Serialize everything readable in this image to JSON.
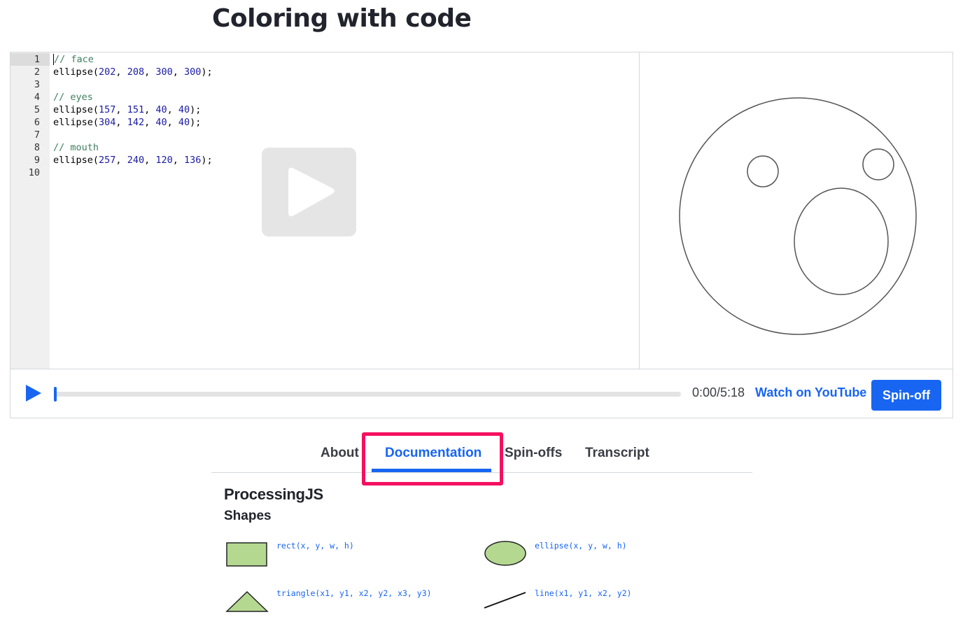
{
  "page": {
    "title": "Coloring with code"
  },
  "editor": {
    "lines": [
      {
        "n": "1",
        "parts": [
          {
            "t": "// face",
            "c": "comment"
          }
        ]
      },
      {
        "n": "2",
        "parts": [
          {
            "t": "ellipse(",
            "c": ""
          },
          {
            "t": "202",
            "c": "num"
          },
          {
            "t": ", ",
            "c": ""
          },
          {
            "t": "208",
            "c": "num"
          },
          {
            "t": ", ",
            "c": ""
          },
          {
            "t": "300",
            "c": "num"
          },
          {
            "t": ", ",
            "c": ""
          },
          {
            "t": "300",
            "c": "num"
          },
          {
            "t": ");",
            "c": ""
          }
        ]
      },
      {
        "n": "3",
        "parts": []
      },
      {
        "n": "4",
        "parts": [
          {
            "t": "// eyes",
            "c": "comment"
          }
        ]
      },
      {
        "n": "5",
        "parts": [
          {
            "t": "ellipse(",
            "c": ""
          },
          {
            "t": "157",
            "c": "num"
          },
          {
            "t": ", ",
            "c": ""
          },
          {
            "t": "151",
            "c": "num"
          },
          {
            "t": ", ",
            "c": ""
          },
          {
            "t": "40",
            "c": "num"
          },
          {
            "t": ", ",
            "c": ""
          },
          {
            "t": "40",
            "c": "num"
          },
          {
            "t": ");",
            "c": ""
          }
        ]
      },
      {
        "n": "6",
        "parts": [
          {
            "t": "ellipse(",
            "c": ""
          },
          {
            "t": "304",
            "c": "num"
          },
          {
            "t": ", ",
            "c": ""
          },
          {
            "t": "142",
            "c": "num"
          },
          {
            "t": ", ",
            "c": ""
          },
          {
            "t": "40",
            "c": "num"
          },
          {
            "t": ", ",
            "c": ""
          },
          {
            "t": "40",
            "c": "num"
          },
          {
            "t": ");",
            "c": ""
          }
        ]
      },
      {
        "n": "7",
        "parts": []
      },
      {
        "n": "8",
        "parts": [
          {
            "t": "// mouth",
            "c": "comment"
          }
        ]
      },
      {
        "n": "9",
        "parts": [
          {
            "t": "ellipse(",
            "c": ""
          },
          {
            "t": "257",
            "c": "num"
          },
          {
            "t": ", ",
            "c": ""
          },
          {
            "t": "240",
            "c": "num"
          },
          {
            "t": ", ",
            "c": ""
          },
          {
            "t": "120",
            "c": "num"
          },
          {
            "t": ", ",
            "c": ""
          },
          {
            "t": "136",
            "c": "num"
          },
          {
            "t": ");",
            "c": ""
          }
        ]
      },
      {
        "n": "10",
        "parts": []
      }
    ]
  },
  "overlay": {
    "icon": "play-icon"
  },
  "controls": {
    "play_icon": "play-icon",
    "progress": 0,
    "time": "0:00/5:18",
    "watch_link": "Watch on YouTube",
    "spinoff_label": "Spin-off"
  },
  "tabs": {
    "items": [
      {
        "label": "About"
      },
      {
        "label": "Documentation"
      },
      {
        "label": "Spin-offs"
      },
      {
        "label": "Transcript"
      }
    ],
    "active": "Documentation"
  },
  "docs": {
    "title": "ProcessingJS",
    "section": "Shapes",
    "items": [
      {
        "label": "rect(x, y, w, h)",
        "icon": "rect-shape-icon"
      },
      {
        "label": "ellipse(x, y, w, h)",
        "icon": "ellipse-shape-icon"
      },
      {
        "label": "triangle(x1, y1, x2, y2, x3, y3)",
        "icon": "triangle-shape-icon"
      },
      {
        "label": "line(x1, y1, x2, y2)",
        "icon": "line-shape-icon"
      }
    ]
  },
  "colors": {
    "accent": "#1865f2",
    "highlight": "#f5105f",
    "shape_fill": "#b5d891"
  }
}
